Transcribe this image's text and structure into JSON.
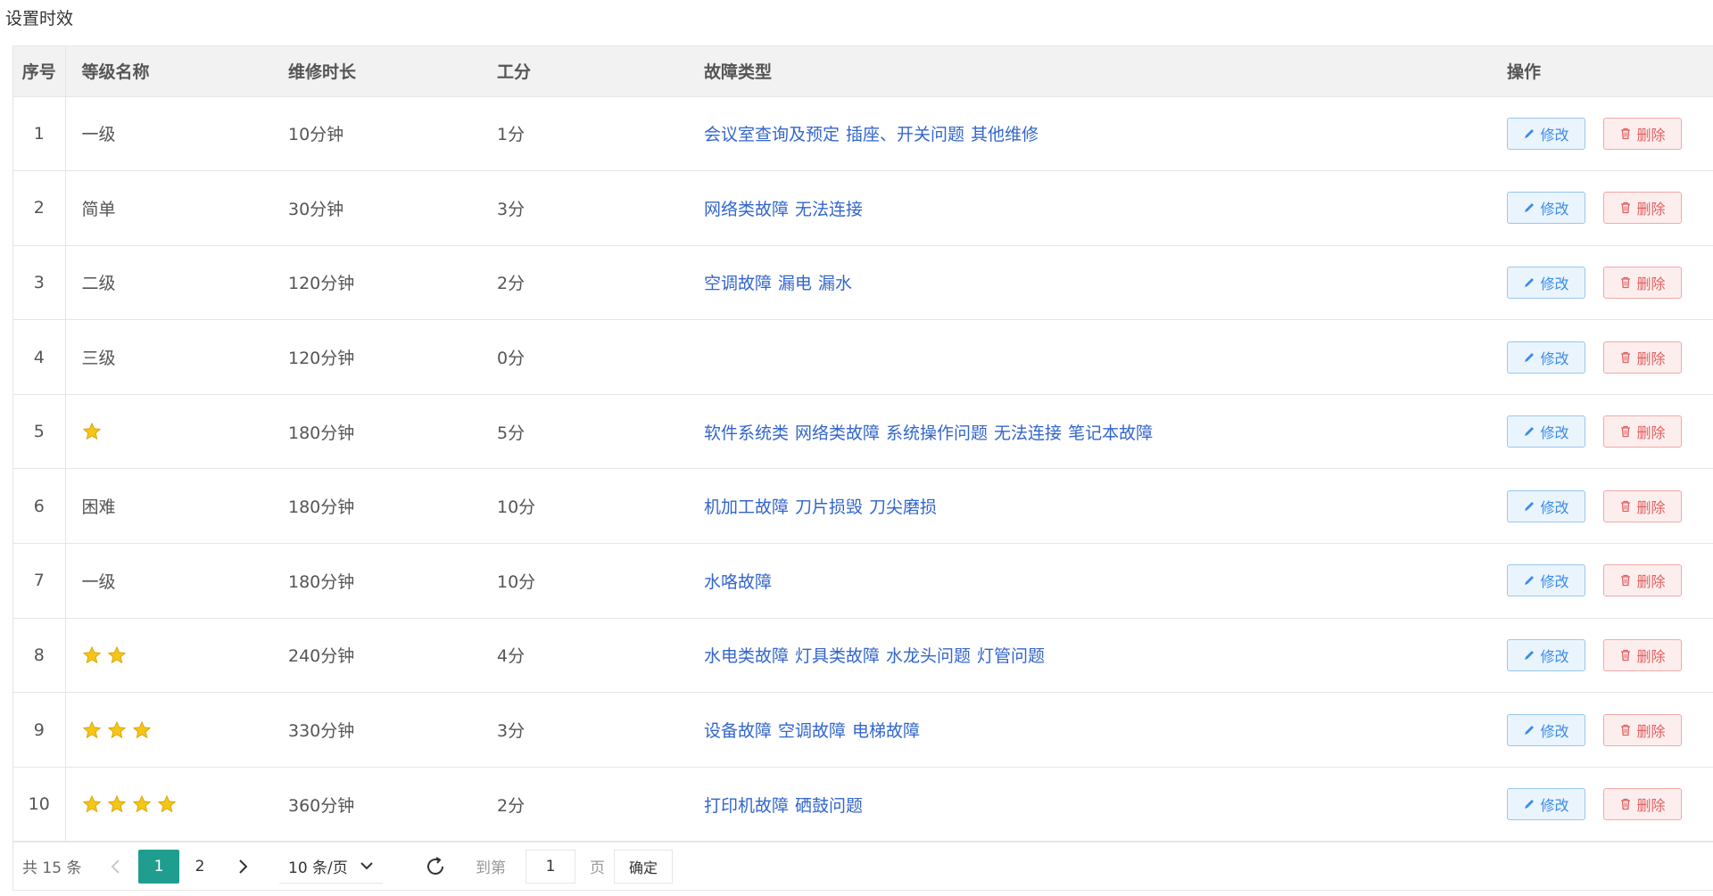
{
  "page": {
    "title": "设置时效"
  },
  "colors": {
    "link": "#3366cc",
    "edit": "#3c8ce7",
    "delete": "#e26060",
    "active_page": "#1f9e8f",
    "star": "#f5c518"
  },
  "table": {
    "headers": {
      "idx": "序号",
      "level": "等级名称",
      "duration": "维修时长",
      "points": "工分",
      "fault": "故障类型",
      "ops": "操作"
    },
    "edit_label": "修改",
    "delete_label": "删除",
    "rows": [
      {
        "idx": "1",
        "level": "一级",
        "stars": 0,
        "duration": "10分钟",
        "points": "1分",
        "faults": [
          "会议室查询及预定",
          "插座、开关问题",
          "其他维修"
        ]
      },
      {
        "idx": "2",
        "level": "简单",
        "stars": 0,
        "duration": "30分钟",
        "points": "3分",
        "faults": [
          "网络类故障",
          "无法连接"
        ]
      },
      {
        "idx": "3",
        "level": "二级",
        "stars": 0,
        "duration": "120分钟",
        "points": "2分",
        "faults": [
          "空调故障",
          "漏电",
          "漏水"
        ]
      },
      {
        "idx": "4",
        "level": "三级",
        "stars": 0,
        "duration": "120分钟",
        "points": "0分",
        "faults": []
      },
      {
        "idx": "5",
        "level": "",
        "stars": 1,
        "duration": "180分钟",
        "points": "5分",
        "faults": [
          "软件系统类",
          "网络类故障",
          "系统操作问题",
          "无法连接",
          "笔记本故障"
        ]
      },
      {
        "idx": "6",
        "level": "困难",
        "stars": 0,
        "duration": "180分钟",
        "points": "10分",
        "faults": [
          "机加工故障",
          "刀片损毁",
          "刀尖磨损"
        ]
      },
      {
        "idx": "7",
        "level": "一级",
        "stars": 0,
        "duration": "180分钟",
        "points": "10分",
        "faults": [
          "水咯故障"
        ]
      },
      {
        "idx": "8",
        "level": "",
        "stars": 2,
        "duration": "240分钟",
        "points": "4分",
        "faults": [
          "水电类故障",
          "灯具类故障",
          "水龙头问题",
          "灯管问题"
        ]
      },
      {
        "idx": "9",
        "level": "",
        "stars": 3,
        "duration": "330分钟",
        "points": "3分",
        "faults": [
          "设备故障",
          "空调故障",
          "电梯故障"
        ]
      },
      {
        "idx": "10",
        "level": "",
        "stars": 4,
        "duration": "360分钟",
        "points": "2分",
        "faults": [
          "打印机故障",
          "硒鼓问题"
        ]
      }
    ]
  },
  "pagination": {
    "total_label": "共 15 条",
    "pages": [
      "1",
      "2"
    ],
    "current_page": "1",
    "page_size_label": "10 条/页",
    "goto_label": "到第",
    "goto_value": "1",
    "page_word": "页",
    "confirm_label": "确定"
  }
}
